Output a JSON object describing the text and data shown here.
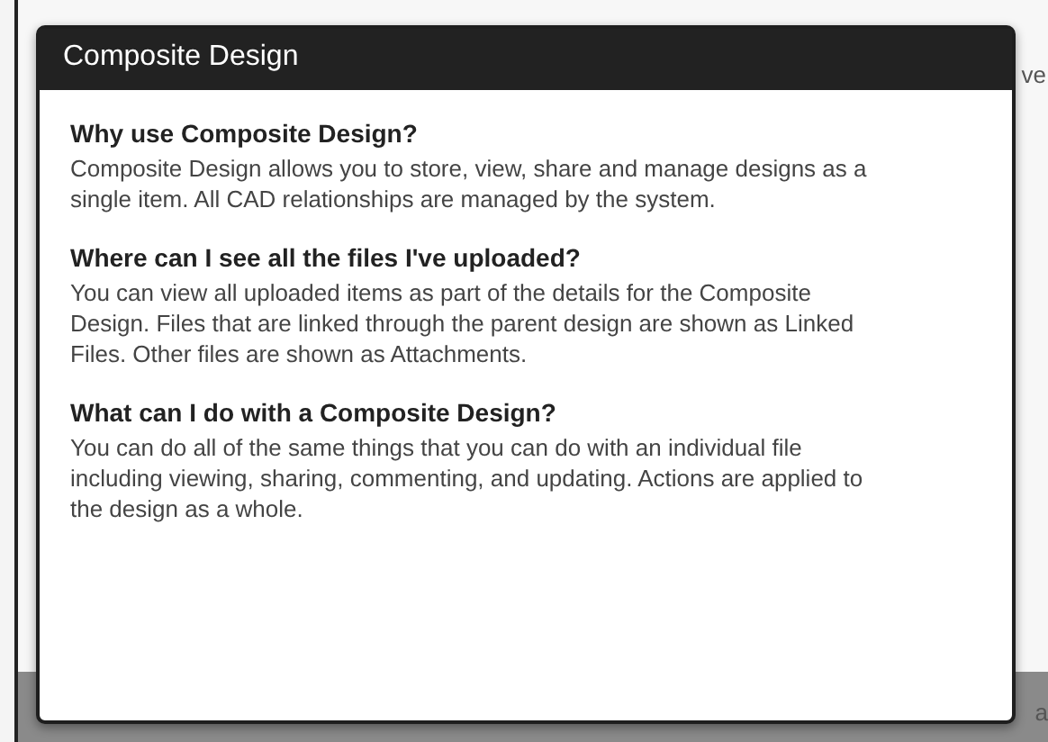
{
  "background": {
    "fragments": [
      "ve",
      "a"
    ]
  },
  "dialog": {
    "title": "Composite Design",
    "sections": [
      {
        "heading": "Why use Composite Design?",
        "body": "Composite Design allows you to store, view, share and manage designs as a single item. All CAD relationships are managed by the system."
      },
      {
        "heading": "Where can I see all the files I've uploaded?",
        "body": "You can view all uploaded items as part of the details for the Composite Design. Files that are linked through the parent design are shown as Linked Files. Other files are shown as Attachments."
      },
      {
        "heading": "What can I do with a Composite Design?",
        "body": "You can do all of the same things that you can do with an individual file including viewing, sharing, commenting, and updating. Actions are applied to the design as a whole."
      }
    ]
  }
}
